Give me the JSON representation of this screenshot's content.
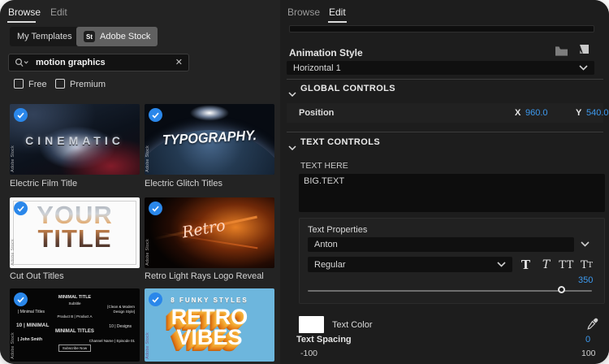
{
  "accent_blue": "#3d9af0",
  "left": {
    "tabs": {
      "browse": "Browse",
      "edit": "Edit"
    },
    "source_tabs": {
      "my_templates": "My Templates",
      "adobe_stock": "Adobe Stock",
      "stock_badge": "St"
    },
    "search": {
      "value": "motion graphics",
      "clear": "✕"
    },
    "filters": {
      "free": "Free",
      "premium": "Premium"
    },
    "watermark": "Adobe Stock",
    "templates": [
      {
        "art": "CINEMATIC",
        "caption": "Electric Film Title"
      },
      {
        "art": "TYPOGRAPHY.",
        "caption": "Electric Glitch Titles"
      },
      {
        "art_line1": "YOUR",
        "art_line2": "TITLE",
        "caption": "Cut Out Titles"
      },
      {
        "art": "Retro",
        "caption": "Retro Light Rays Logo Reveal"
      },
      {
        "items": [
          "MINIMAL TITLE",
          "Subtitle",
          "| Minimal Titles",
          "10 | MINIMAL",
          "Product B | Product A",
          "[Clean & Modern Design Style]",
          "MINIMAL TITLES",
          "10 | Designs",
          "| John Smith",
          "Subscribe Now",
          "Channel Name | Episode 01"
        ]
      },
      {
        "tagline": "8 FUNKY STYLES",
        "art_line1": "RETRO",
        "art_line2": "VIBES"
      }
    ]
  },
  "right": {
    "tabs": {
      "browse": "Browse",
      "edit": "Edit"
    },
    "animation_style": {
      "label": "Animation Style",
      "value": "Horizontal 1"
    },
    "global_controls": {
      "title": "GLOBAL CONTROLS",
      "position": {
        "label": "Position",
        "x_label": "X",
        "x": "960.0",
        "y_label": "Y",
        "y": "540.0"
      }
    },
    "text_controls": {
      "title": "TEXT CONTROLS",
      "text_field": {
        "label": "TEXT HERE",
        "value": "BIG.TEXT"
      },
      "properties": {
        "label": "Text Properties",
        "font": "Anton",
        "style": "Regular",
        "buttons": {
          "faux_bold": "T",
          "faux_italic": "T",
          "all_caps": "TT",
          "small_caps_big": "T",
          "small_caps_small": "T"
        },
        "size": "350"
      },
      "color": {
        "label": "Text Color"
      },
      "spacing": {
        "label": "Text Spacing",
        "value": "0",
        "min": "-100",
        "max": "100"
      }
    }
  }
}
